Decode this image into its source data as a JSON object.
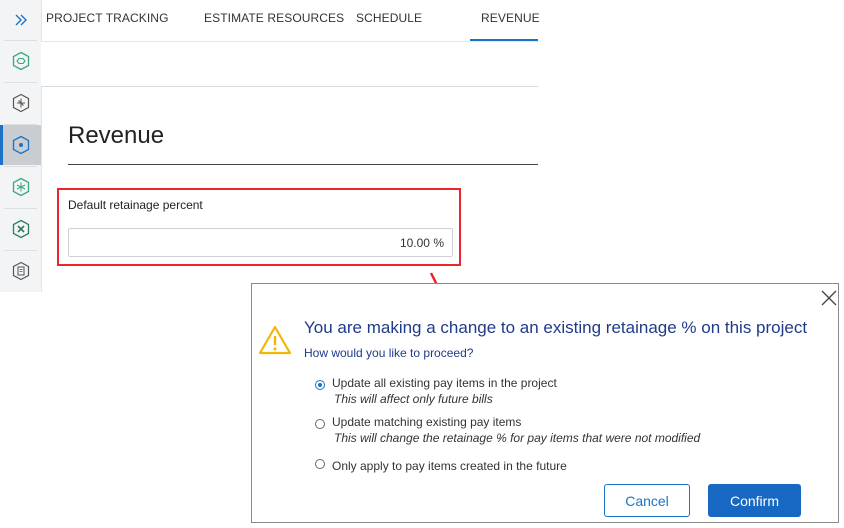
{
  "icons": {
    "expand": "double-chevron-right-icon",
    "rail": [
      "hexagon-icon",
      "hexagon-sparkle-icon",
      "hexagon-dot-icon",
      "hexagon-burst-icon",
      "hexagon-cross-icon",
      "hexagon-document-icon"
    ],
    "close": "close-icon",
    "warning": "warning-icon"
  },
  "tabs": [
    {
      "label": "PROJECT TRACKING"
    },
    {
      "label": "ESTIMATE RESOURCES"
    },
    {
      "label": "SCHEDULE"
    },
    {
      "label": "REVENUE",
      "active": true
    }
  ],
  "page": {
    "title": "Revenue",
    "field_label": "Default retainage percent",
    "field_value": "10.00 %"
  },
  "dialog": {
    "title": "You are making a change to an existing retainage % on this project",
    "question": "How would you like to proceed?",
    "options": [
      {
        "label": "Update all existing pay items in the project",
        "subtext": "This will affect only future bills",
        "selected": true
      },
      {
        "label": "Update matching existing pay items",
        "subtext": "This will change the retainage % for pay items that were not modified",
        "selected": false
      },
      {
        "label": "Only apply to pay items created in the future",
        "subtext": "",
        "selected": false
      }
    ],
    "cancel_label": "Cancel",
    "confirm_label": "Confirm"
  },
  "colors": {
    "accent": "#1a73c8",
    "highlight": "#e8262b",
    "dialog_text": "#1f3a8a",
    "warning": "#f2b705",
    "rail_icon": "#3aa67e"
  }
}
